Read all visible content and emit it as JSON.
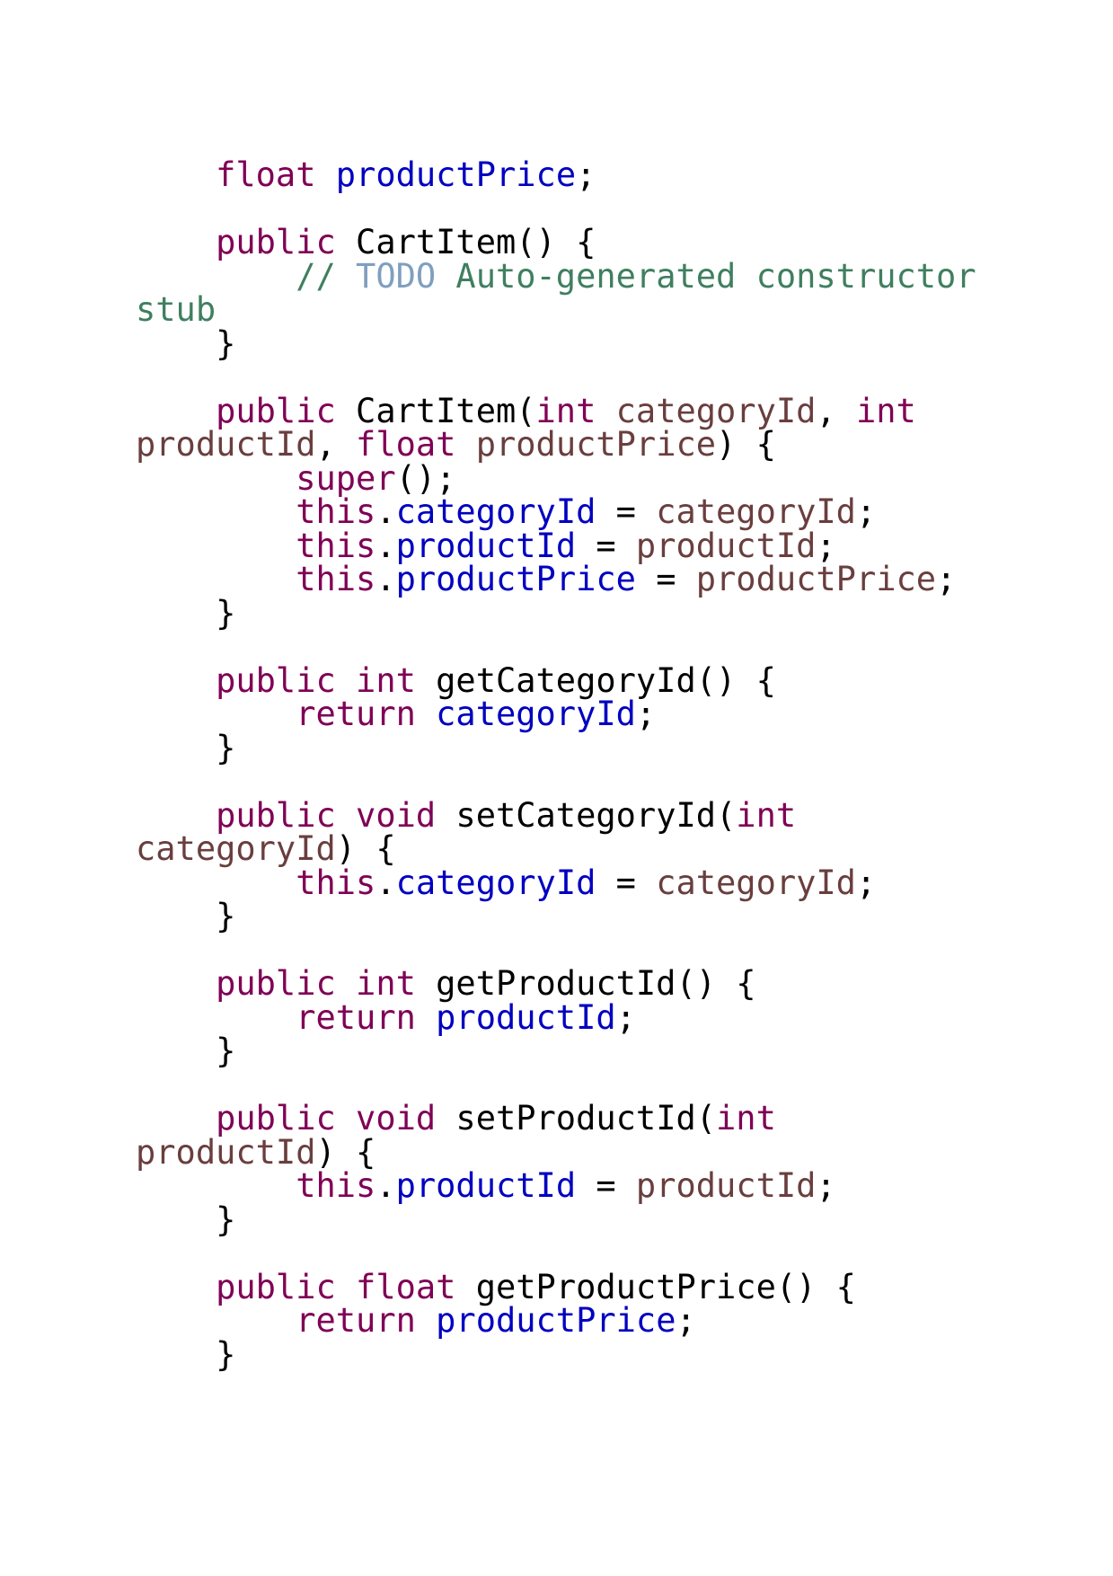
{
  "theme": {
    "keyword": "#7f0055",
    "field": "#0000c0",
    "parameter": "#6a3e3e",
    "comment": "#3f7f5f",
    "task_tag": "#7f9fbf",
    "default": "#000000"
  },
  "lines": [
    [
      {
        "t": "    "
      },
      {
        "t": "float",
        "c": "kw"
      },
      {
        "t": " "
      },
      {
        "t": "productPrice",
        "c": "field"
      },
      {
        "t": ";"
      }
    ],
    [
      {
        "t": ""
      }
    ],
    [
      {
        "t": "    "
      },
      {
        "t": "public",
        "c": "kw"
      },
      {
        "t": " CartItem() {"
      }
    ],
    [
      {
        "t": "        "
      },
      {
        "t": "// ",
        "c": "comment"
      },
      {
        "t": "TODO",
        "c": "todo"
      },
      {
        "t": " Auto-generated constructor",
        "c": "comment"
      }
    ],
    [
      {
        "t": "stub",
        "c": "comment"
      }
    ],
    [
      {
        "t": "    }"
      }
    ],
    [
      {
        "t": ""
      }
    ],
    [
      {
        "t": "    "
      },
      {
        "t": "public",
        "c": "kw"
      },
      {
        "t": " CartItem("
      },
      {
        "t": "int",
        "c": "kw"
      },
      {
        "t": " "
      },
      {
        "t": "categoryId",
        "c": "param"
      },
      {
        "t": ", "
      },
      {
        "t": "int",
        "c": "kw"
      }
    ],
    [
      {
        "t": "productId",
        "c": "param"
      },
      {
        "t": ", "
      },
      {
        "t": "float",
        "c": "kw"
      },
      {
        "t": " "
      },
      {
        "t": "productPrice",
        "c": "param"
      },
      {
        "t": ") {"
      }
    ],
    [
      {
        "t": "        "
      },
      {
        "t": "super",
        "c": "kw"
      },
      {
        "t": "();"
      }
    ],
    [
      {
        "t": "        "
      },
      {
        "t": "this",
        "c": "kw"
      },
      {
        "t": "."
      },
      {
        "t": "categoryId",
        "c": "field"
      },
      {
        "t": " = "
      },
      {
        "t": "categoryId",
        "c": "param"
      },
      {
        "t": ";"
      }
    ],
    [
      {
        "t": "        "
      },
      {
        "t": "this",
        "c": "kw"
      },
      {
        "t": "."
      },
      {
        "t": "productId",
        "c": "field"
      },
      {
        "t": " = "
      },
      {
        "t": "productId",
        "c": "param"
      },
      {
        "t": ";"
      }
    ],
    [
      {
        "t": "        "
      },
      {
        "t": "this",
        "c": "kw"
      },
      {
        "t": "."
      },
      {
        "t": "productPrice",
        "c": "field"
      },
      {
        "t": " = "
      },
      {
        "t": "productPrice",
        "c": "param"
      },
      {
        "t": ";"
      }
    ],
    [
      {
        "t": "    }"
      }
    ],
    [
      {
        "t": ""
      }
    ],
    [
      {
        "t": "    "
      },
      {
        "t": "public",
        "c": "kw"
      },
      {
        "t": " "
      },
      {
        "t": "int",
        "c": "kw"
      },
      {
        "t": " getCategoryId() {"
      }
    ],
    [
      {
        "t": "        "
      },
      {
        "t": "return",
        "c": "kw"
      },
      {
        "t": " "
      },
      {
        "t": "categoryId",
        "c": "field"
      },
      {
        "t": ";"
      }
    ],
    [
      {
        "t": "    }"
      }
    ],
    [
      {
        "t": ""
      }
    ],
    [
      {
        "t": "    "
      },
      {
        "t": "public",
        "c": "kw"
      },
      {
        "t": " "
      },
      {
        "t": "void",
        "c": "kw"
      },
      {
        "t": " setCategoryId("
      },
      {
        "t": "int",
        "c": "kw"
      }
    ],
    [
      {
        "t": "categoryId",
        "c": "param"
      },
      {
        "t": ") {"
      }
    ],
    [
      {
        "t": "        "
      },
      {
        "t": "this",
        "c": "kw"
      },
      {
        "t": "."
      },
      {
        "t": "categoryId",
        "c": "field"
      },
      {
        "t": " = "
      },
      {
        "t": "categoryId",
        "c": "param"
      },
      {
        "t": ";"
      }
    ],
    [
      {
        "t": "    }"
      }
    ],
    [
      {
        "t": ""
      }
    ],
    [
      {
        "t": "    "
      },
      {
        "t": "public",
        "c": "kw"
      },
      {
        "t": " "
      },
      {
        "t": "int",
        "c": "kw"
      },
      {
        "t": " getProductId() {"
      }
    ],
    [
      {
        "t": "        "
      },
      {
        "t": "return",
        "c": "kw"
      },
      {
        "t": " "
      },
      {
        "t": "productId",
        "c": "field"
      },
      {
        "t": ";"
      }
    ],
    [
      {
        "t": "    }"
      }
    ],
    [
      {
        "t": ""
      }
    ],
    [
      {
        "t": "    "
      },
      {
        "t": "public",
        "c": "kw"
      },
      {
        "t": " "
      },
      {
        "t": "void",
        "c": "kw"
      },
      {
        "t": " setProductId("
      },
      {
        "t": "int",
        "c": "kw"
      }
    ],
    [
      {
        "t": "productId",
        "c": "param"
      },
      {
        "t": ") {"
      }
    ],
    [
      {
        "t": "        "
      },
      {
        "t": "this",
        "c": "kw"
      },
      {
        "t": "."
      },
      {
        "t": "productId",
        "c": "field"
      },
      {
        "t": " = "
      },
      {
        "t": "productId",
        "c": "param"
      },
      {
        "t": ";"
      }
    ],
    [
      {
        "t": "    }"
      }
    ],
    [
      {
        "t": ""
      }
    ],
    [
      {
        "t": "    "
      },
      {
        "t": "public",
        "c": "kw"
      },
      {
        "t": " "
      },
      {
        "t": "float",
        "c": "kw"
      },
      {
        "t": " getProductPrice() {"
      }
    ],
    [
      {
        "t": "        "
      },
      {
        "t": "return",
        "c": "kw"
      },
      {
        "t": " "
      },
      {
        "t": "productPrice",
        "c": "field"
      },
      {
        "t": ";"
      }
    ],
    [
      {
        "t": "    }"
      }
    ]
  ]
}
